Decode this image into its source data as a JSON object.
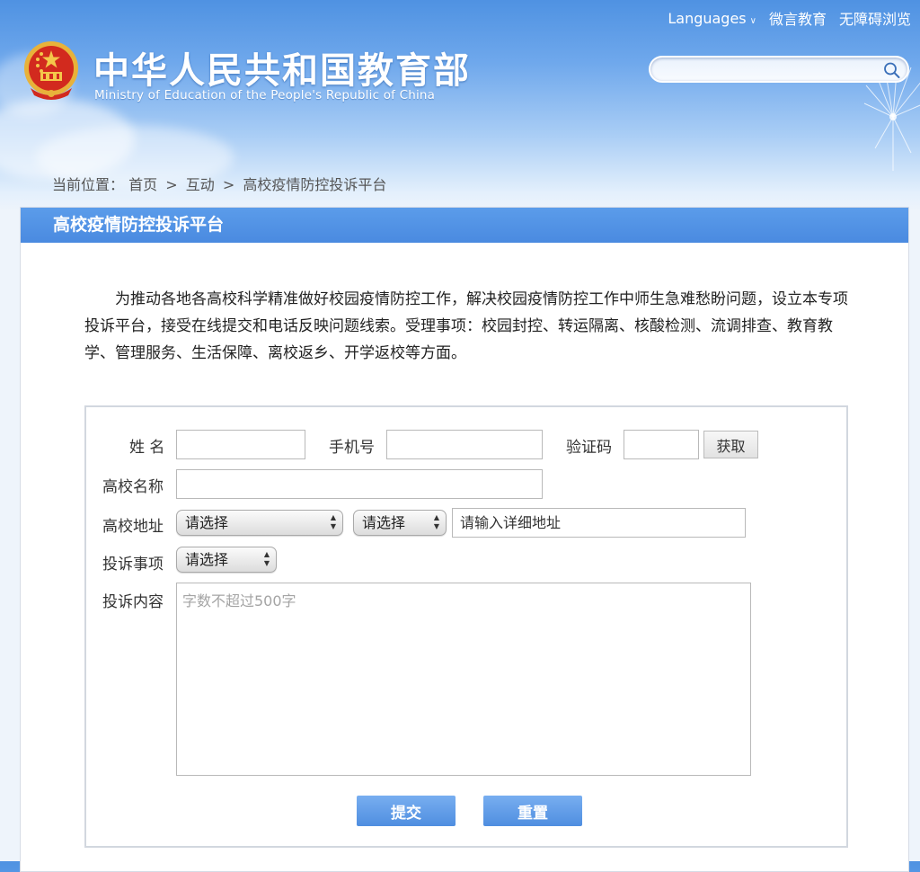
{
  "header": {
    "nav": {
      "languages": "Languages",
      "weiyan": "微言教育",
      "accessibility": "无障碍浏览"
    },
    "title": "中华人民共和国教育部",
    "subtitle": "Ministry of Education of the People's Republic of China",
    "search": {
      "placeholder": ""
    },
    "icons": {
      "emblem": "national-emblem",
      "search": "search-icon",
      "languages_caret": "chevron-down-icon"
    }
  },
  "breadcrumb": {
    "prefix": "当前位置：",
    "items": [
      "首页",
      "互动",
      "高校疫情防控投诉平台"
    ],
    "separator": ">"
  },
  "panel": {
    "title": "高校疫情防控投诉平台",
    "intro": "为推动各地各高校科学精准做好校园疫情防控工作，解决校园疫情防控工作中师生急难愁盼问题，设立本专项投诉平台，接受在线提交和电话反映问题线索。受理事项：校园封控、转运隔离、核酸检测、流调排查、教育教学、管理服务、生活保障、离校返乡、开学返校等方面。"
  },
  "form": {
    "name_label": "姓 名",
    "name_value": "",
    "phone_label": "手机号",
    "phone_value": "",
    "code_label": "验证码",
    "code_value": "",
    "get_code_button": "获取",
    "school_label": "高校名称",
    "school_value": "",
    "address_label": "高校地址",
    "province_select": "请选择",
    "city_select": "请选择",
    "address_placeholder": "请输入详细地址",
    "matter_label": "投诉事项",
    "matter_select": "请选择",
    "content_label": "投诉内容",
    "content_placeholder": "字数不超过500字",
    "submit_button": "提交",
    "reset_button": "重置"
  },
  "colors": {
    "header_blue": "#4f92e2",
    "panel_bar": "#4a8ae0",
    "button_blue": "#5a97e6"
  }
}
